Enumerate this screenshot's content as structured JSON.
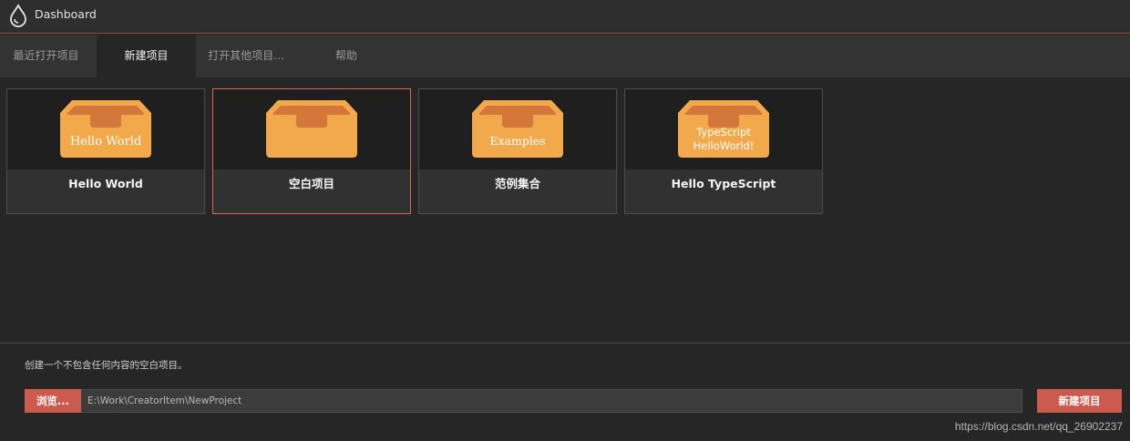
{
  "app": {
    "title": "Dashboard"
  },
  "tabs": [
    {
      "label": "最近打开项目",
      "active": false
    },
    {
      "label": "新建项目",
      "active": true
    },
    {
      "label": "打开其他项目...",
      "active": false
    },
    {
      "label": "帮助",
      "active": false
    }
  ],
  "templates": [
    {
      "name": "Hello World",
      "box_text": "Hello World",
      "selected": false
    },
    {
      "name": "空白项目",
      "box_text": "",
      "selected": true
    },
    {
      "name": "范例集合",
      "box_text": "Examples",
      "selected": false
    },
    {
      "name": "Hello TypeScript",
      "box_text_line1": "TypeScript",
      "box_text_line2": "HelloWorld!",
      "selected": false
    }
  ],
  "footer": {
    "description": "创建一个不包含任何内容的空白项目。",
    "browse_label": "浏览...",
    "path_value": "E:\\Work\\CreatorItem\\NewProject",
    "create_label": "新建项目"
  },
  "watermark": "https://blog.csdn.net/qq_26902237",
  "colors": {
    "accent": "#cc5a4e",
    "box_body": "#f2a94c",
    "box_inner": "#d4773a",
    "background": "#262626"
  }
}
